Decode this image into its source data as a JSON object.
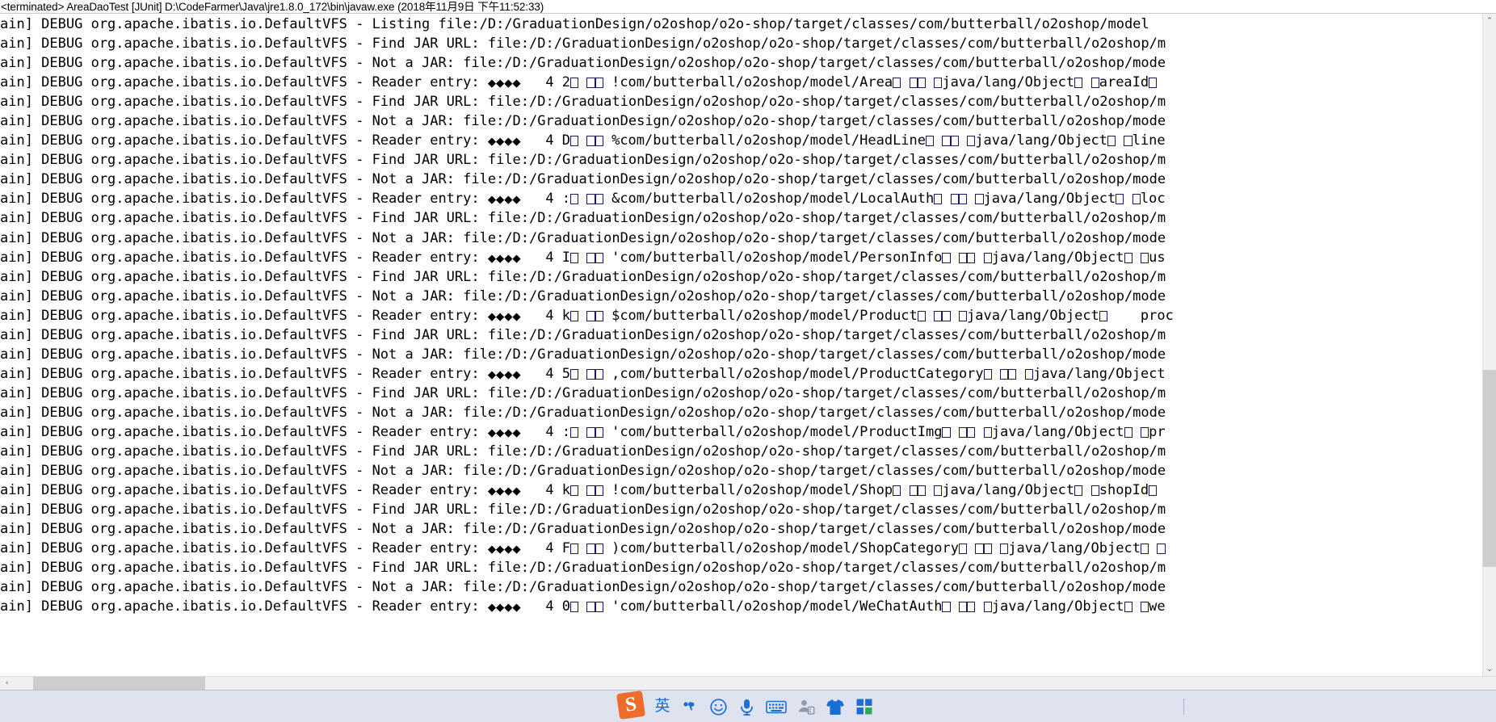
{
  "window": {
    "title": "<terminated> AreaDaoTest [JUnit] D:\\CodeFarmer\\Java\\jre1.8.0_172\\bin\\javaw.exe (2018年11月9日 下午11:52:33)"
  },
  "console": {
    "lines": [
      "ain] DEBUG org.apache.ibatis.io.DefaultVFS - Listing file:/D:/GraduationDesign/o2oshop/o2o-shop/target/classes/com/butterball/o2oshop/model",
      "ain] DEBUG org.apache.ibatis.io.DefaultVFS - Find JAR URL: file:/D:/GraduationDesign/o2oshop/o2o-shop/target/classes/com/butterball/o2oshop/m",
      "ain] DEBUG org.apache.ibatis.io.DefaultVFS - Not a JAR: file:/D:/GraduationDesign/o2oshop/o2o-shop/target/classes/com/butterball/o2oshop/mode",
      "ain] DEBUG org.apache.ibatis.io.DefaultVFS - Reader entry: ◆◆◆◆   4 2□ □□ !com/butterball/o2oshop/model/Area□ □□ □java/lang/Object□ □areaId□",
      "ain] DEBUG org.apache.ibatis.io.DefaultVFS - Find JAR URL: file:/D:/GraduationDesign/o2oshop/o2o-shop/target/classes/com/butterball/o2oshop/m",
      "ain] DEBUG org.apache.ibatis.io.DefaultVFS - Not a JAR: file:/D:/GraduationDesign/o2oshop/o2o-shop/target/classes/com/butterball/o2oshop/mode",
      "ain] DEBUG org.apache.ibatis.io.DefaultVFS - Reader entry: ◆◆◆◆   4 D□ □□ %com/butterball/o2oshop/model/HeadLine□ □□ □java/lang/Object□ □line",
      "ain] DEBUG org.apache.ibatis.io.DefaultVFS - Find JAR URL: file:/D:/GraduationDesign/o2oshop/o2o-shop/target/classes/com/butterball/o2oshop/m",
      "ain] DEBUG org.apache.ibatis.io.DefaultVFS - Not a JAR: file:/D:/GraduationDesign/o2oshop/o2o-shop/target/classes/com/butterball/o2oshop/mode",
      "ain] DEBUG org.apache.ibatis.io.DefaultVFS - Reader entry: ◆◆◆◆   4 :□ □□ &com/butterball/o2oshop/model/LocalAuth□ □□ □java/lang/Object□ □loc",
      "ain] DEBUG org.apache.ibatis.io.DefaultVFS - Find JAR URL: file:/D:/GraduationDesign/o2oshop/o2o-shop/target/classes/com/butterball/o2oshop/m",
      "ain] DEBUG org.apache.ibatis.io.DefaultVFS - Not a JAR: file:/D:/GraduationDesign/o2oshop/o2o-shop/target/classes/com/butterball/o2oshop/mode",
      "ain] DEBUG org.apache.ibatis.io.DefaultVFS - Reader entry: ◆◆◆◆   4 I□ □□ 'com/butterball/o2oshop/model/PersonInfo□ □□ □java/lang/Object□ □us",
      "ain] DEBUG org.apache.ibatis.io.DefaultVFS - Find JAR URL: file:/D:/GraduationDesign/o2oshop/o2o-shop/target/classes/com/butterball/o2oshop/m",
      "ain] DEBUG org.apache.ibatis.io.DefaultVFS - Not a JAR: file:/D:/GraduationDesign/o2oshop/o2o-shop/target/classes/com/butterball/o2oshop/mode",
      "ain] DEBUG org.apache.ibatis.io.DefaultVFS - Reader entry: ◆◆◆◆   4 k□ □□ $com/butterball/o2oshop/model/Product□ □□ □java/lang/Object□    proc",
      "ain] DEBUG org.apache.ibatis.io.DefaultVFS - Find JAR URL: file:/D:/GraduationDesign/o2oshop/o2o-shop/target/classes/com/butterball/o2oshop/m",
      "ain] DEBUG org.apache.ibatis.io.DefaultVFS - Not a JAR: file:/D:/GraduationDesign/o2oshop/o2o-shop/target/classes/com/butterball/o2oshop/mode",
      "ain] DEBUG org.apache.ibatis.io.DefaultVFS - Reader entry: ◆◆◆◆   4 5□ □□ ,com/butterball/o2oshop/model/ProductCategory□ □□ □java/lang/Object",
      "ain] DEBUG org.apache.ibatis.io.DefaultVFS - Find JAR URL: file:/D:/GraduationDesign/o2oshop/o2o-shop/target/classes/com/butterball/o2oshop/m",
      "ain] DEBUG org.apache.ibatis.io.DefaultVFS - Not a JAR: file:/D:/GraduationDesign/o2oshop/o2o-shop/target/classes/com/butterball/o2oshop/mode",
      "ain] DEBUG org.apache.ibatis.io.DefaultVFS - Reader entry: ◆◆◆◆   4 :□ □□ 'com/butterball/o2oshop/model/ProductImg□ □□ □java/lang/Object□ □pr",
      "ain] DEBUG org.apache.ibatis.io.DefaultVFS - Find JAR URL: file:/D:/GraduationDesign/o2oshop/o2o-shop/target/classes/com/butterball/o2oshop/m",
      "ain] DEBUG org.apache.ibatis.io.DefaultVFS - Not a JAR: file:/D:/GraduationDesign/o2oshop/o2o-shop/target/classes/com/butterball/o2oshop/mode",
      "ain] DEBUG org.apache.ibatis.io.DefaultVFS - Reader entry: ◆◆◆◆   4 k□ □□ !com/butterball/o2oshop/model/Shop□ □□ □java/lang/Object□ □shopId□",
      "ain] DEBUG org.apache.ibatis.io.DefaultVFS - Find JAR URL: file:/D:/GraduationDesign/o2oshop/o2o-shop/target/classes/com/butterball/o2oshop/m",
      "ain] DEBUG org.apache.ibatis.io.DefaultVFS - Not a JAR: file:/D:/GraduationDesign/o2oshop/o2o-shop/target/classes/com/butterball/o2oshop/mode",
      "ain] DEBUG org.apache.ibatis.io.DefaultVFS - Reader entry: ◆◆◆◆   4 F□ □□ )com/butterball/o2oshop/model/ShopCategory□ □□ □java/lang/Object□ □",
      "ain] DEBUG org.apache.ibatis.io.DefaultVFS - Find JAR URL: file:/D:/GraduationDesign/o2oshop/o2o-shop/target/classes/com/butterball/o2oshop/m",
      "ain] DEBUG org.apache.ibatis.io.DefaultVFS - Not a JAR: file:/D:/GraduationDesign/o2oshop/o2o-shop/target/classes/com/butterball/o2oshop/mode",
      "ain] DEBUG org.apache.ibatis.io.DefaultVFS - Reader entry: ◆◆◆◆   4 0□ □□ 'com/butterball/o2oshop/model/WeChatAuth□ □□ □java/lang/Object□ □we"
    ]
  },
  "scrollbars": {
    "vertical": {
      "up_arrow": "⌃",
      "down_arrow": "⌄"
    },
    "horizontal": {
      "left_arrow": "‹",
      "right_arrow": "›"
    }
  },
  "taskbar": {
    "ime": {
      "logo_label": "S",
      "mode_label": "英",
      "items": [
        {
          "name": "punctuation-toggle-icon",
          "glyph": "，"
        },
        {
          "name": "emoji-icon",
          "glyph": "☺"
        },
        {
          "name": "voice-input-icon",
          "glyph": "🎙"
        },
        {
          "name": "soft-keyboard-icon",
          "glyph": "⌨"
        },
        {
          "name": "user-account-icon",
          "glyph": "♟"
        },
        {
          "name": "skin-tshirt-icon",
          "glyph": "👕"
        },
        {
          "name": "toolbox-icon",
          "glyph": "▦"
        }
      ]
    }
  },
  "colors": {
    "console_bg": "#ffffff",
    "console_text": "#000000",
    "scrollbar_track": "#f0f0f0",
    "scrollbar_thumb": "#cdcdcd",
    "taskbar_bg": "#dfe3f0",
    "ime_accent": "#1a6fd4",
    "sogou_orange": "#ef6c2a"
  }
}
